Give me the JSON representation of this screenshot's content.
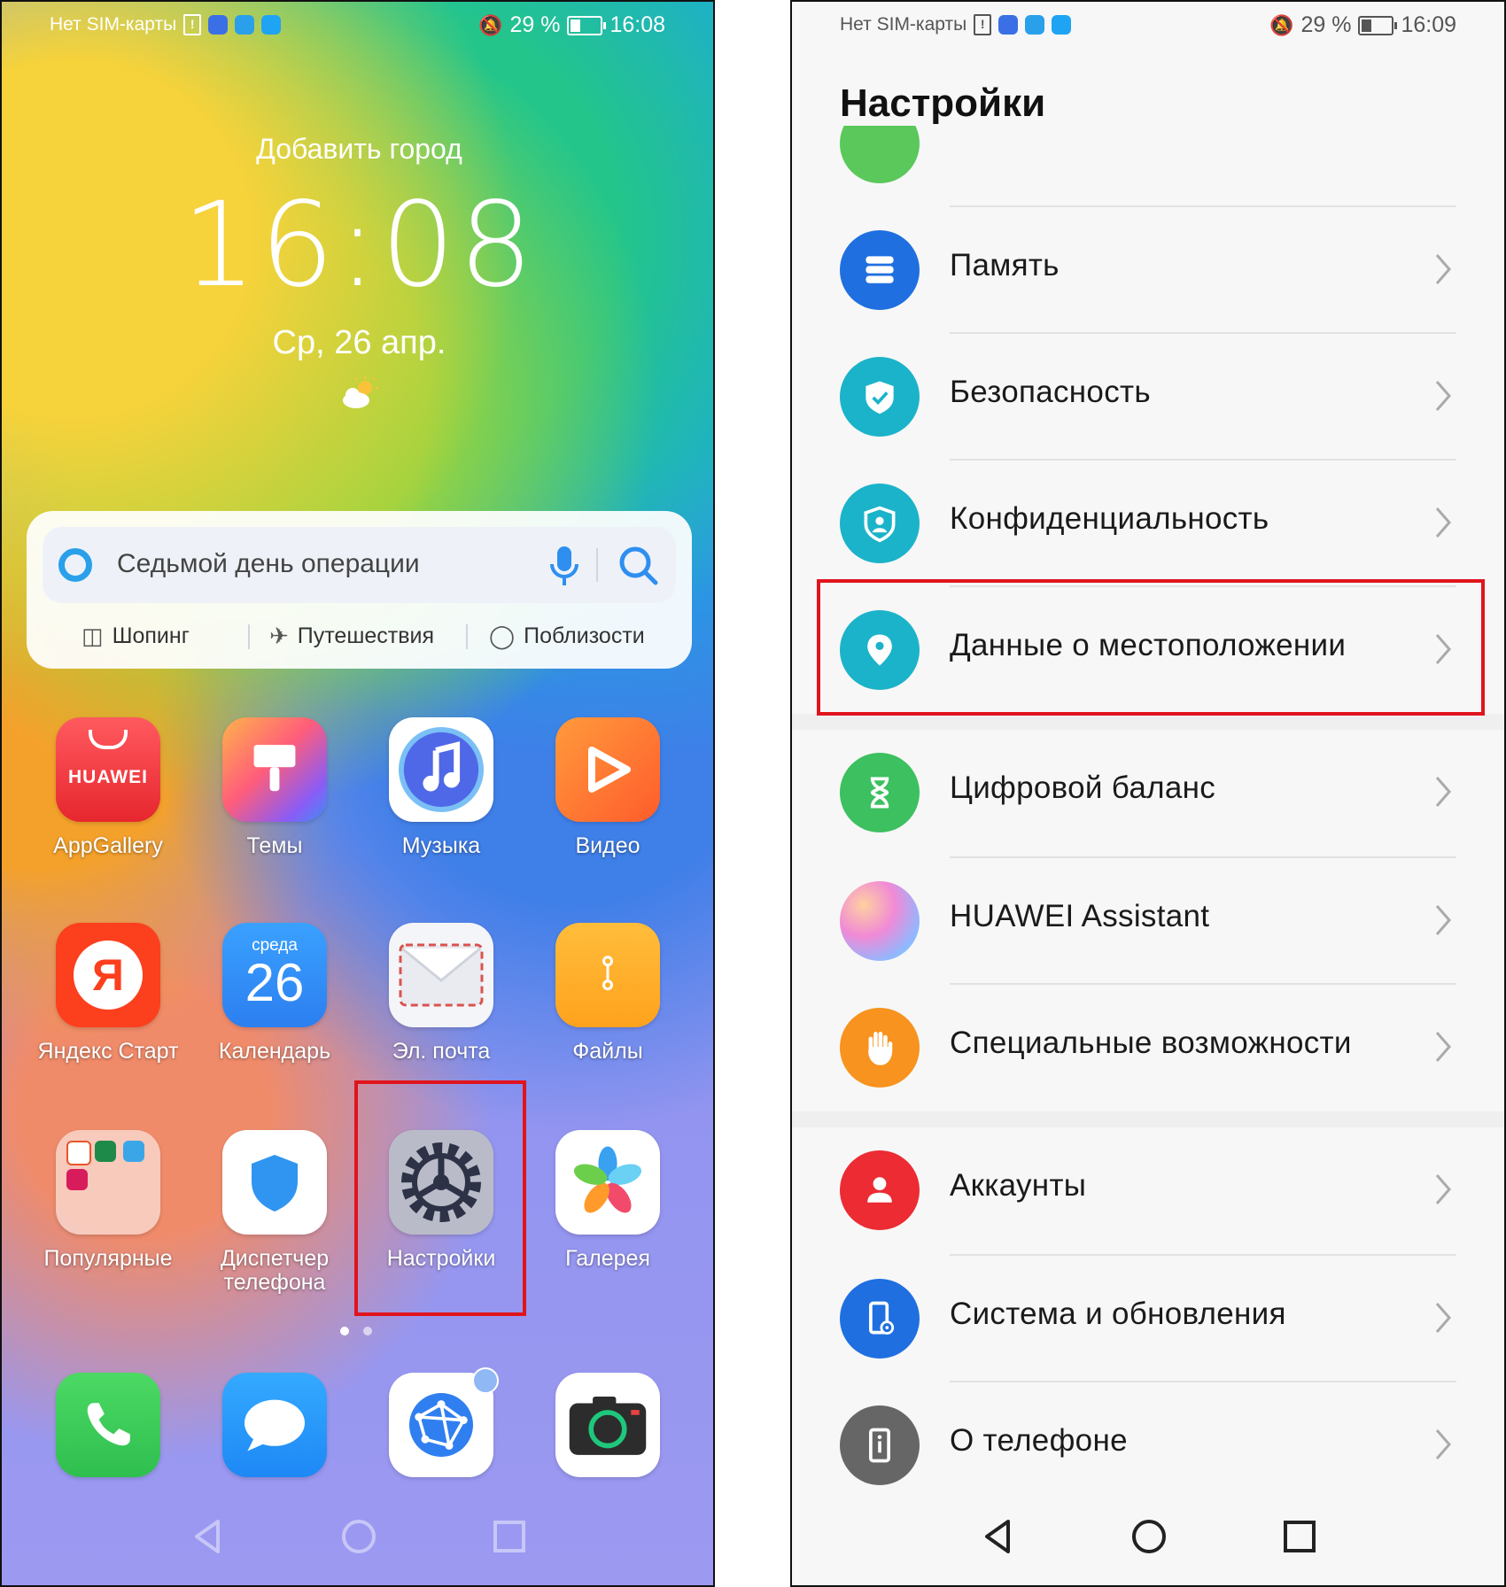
{
  "left_phone": {
    "status": {
      "carrier": "Нет SIM-карты",
      "battery": "29 %",
      "time": "16:08"
    },
    "weather": {
      "city": "Добавить город",
      "time": "16:08",
      "date": "Ср, 26 апр."
    },
    "search": {
      "query": "Седьмой день операции",
      "chips": [
        "Шопинг",
        "Путешествия",
        "Поблизости"
      ]
    },
    "apps": [
      {
        "label": "AppGallery",
        "badge": "HUAWEI"
      },
      {
        "label": "Темы"
      },
      {
        "label": "Музыка"
      },
      {
        "label": "Видео"
      },
      {
        "label": "Яндекс Старт",
        "badge": "Я"
      },
      {
        "label": "Календарь",
        "weekday": "среда",
        "day": "26"
      },
      {
        "label": "Эл. почта"
      },
      {
        "label": "Файлы"
      },
      {
        "label": "Популярные"
      },
      {
        "label": "Диспетчер телефона"
      },
      {
        "label": "Настройки"
      },
      {
        "label": "Галерея"
      }
    ],
    "dock": [
      "phone",
      "messages",
      "browser",
      "camera"
    ]
  },
  "right_phone": {
    "status": {
      "carrier": "Нет SIM-карты",
      "battery": "29 %",
      "time": "16:09"
    },
    "title": "Настройки",
    "items": [
      {
        "label": "Память",
        "color": "#1f6fe0",
        "icon": "storage-icon"
      },
      {
        "label": "Безопасность",
        "color": "#1bb3c9",
        "icon": "shield-check-icon"
      },
      {
        "label": "Конфиденциальность",
        "color": "#1bb3c9",
        "icon": "privacy-icon"
      },
      {
        "label": "Данные о местоположении",
        "color": "#1bb3c9",
        "icon": "location-icon"
      },
      {
        "label": "Цифровой баланс",
        "color": "#3cc060",
        "icon": "hourglass-icon"
      },
      {
        "label": "HUAWEI Assistant",
        "color": "#d98cd8",
        "icon": "assistant-icon"
      },
      {
        "label": "Специальные возможности",
        "color": "#f7931e",
        "icon": "hand-icon"
      },
      {
        "label": "Аккаунты",
        "color": "#ec2b33",
        "icon": "person-icon"
      },
      {
        "label": "Система и обновления",
        "color": "#1f6fe0",
        "icon": "phone-gear-icon"
      },
      {
        "label": "О телефоне",
        "color": "#666666",
        "icon": "info-icon"
      }
    ]
  },
  "highlight_color": "#e0141d"
}
